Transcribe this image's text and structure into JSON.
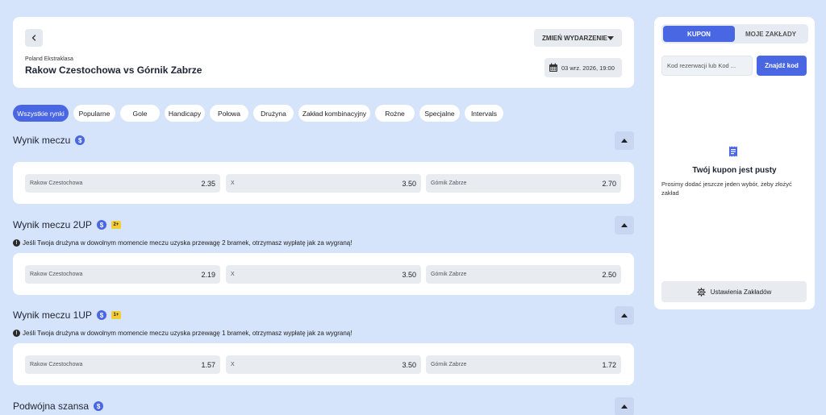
{
  "header": {
    "change_event_label": "ZMIEŃ WYDARZENIE",
    "league": "Poland Ekstraklasa",
    "match_title": "Rakow Czestochowa vs Górnik Zabrze",
    "datetime": "03 wrz. 2026, 19:00"
  },
  "tabs": [
    {
      "label": "Wszystkie rynki",
      "active": true
    },
    {
      "label": "Popularne"
    },
    {
      "label": "Gole"
    },
    {
      "label": "Handicapy"
    },
    {
      "label": "Połowa"
    },
    {
      "label": "Drużyna"
    },
    {
      "label": "Zakład kombinacyjny"
    },
    {
      "label": "Rożne"
    },
    {
      "label": "Specjalne"
    },
    {
      "label": "Intervals"
    }
  ],
  "markets": [
    {
      "title": "Wynik meczu",
      "odds": [
        {
          "label": "Rakow Czestochowa",
          "value": "2.35"
        },
        {
          "label": "X",
          "value": "3.50"
        },
        {
          "label": "Górnik Zabrze",
          "value": "2.70"
        }
      ]
    },
    {
      "title": "Wynik meczu 2UP",
      "badge": "2+",
      "info": "Jeśli Twoja drużyna w dowolnym momencie meczu uzyska przewagę 2 bramek, otrzymasz wypłatę jak za wygraną!",
      "odds": [
        {
          "label": "Rakow Czestochowa",
          "value": "2.19"
        },
        {
          "label": "X",
          "value": "3.50"
        },
        {
          "label": "Górnik Zabrze",
          "value": "2.50"
        }
      ]
    },
    {
      "title": "Wynik meczu 1UP",
      "badge": "1+",
      "info": "Jeśli Twoja drużyna w dowolnym momencie meczu uzyska przewagę 1 bramek, otrzymasz wypłatę jak za wygraną!",
      "odds": [
        {
          "label": "Rakow Czestochowa",
          "value": "1.57"
        },
        {
          "label": "X",
          "value": "3.50"
        },
        {
          "label": "Górnik Zabrze",
          "value": "1.72"
        }
      ]
    },
    {
      "title": "Podwójna szansa"
    }
  ],
  "coin_symbol": "$",
  "info_symbol": "!",
  "sidebar": {
    "tab_coupon": "KUPON",
    "tab_my_bets": "MOJE ZAKŁADY",
    "code_placeholder": "Kod rezerwacji lub Kod ...",
    "find_code_label": "Znajdź kod",
    "empty_title": "Twój kupon jest pusty",
    "empty_desc": "Prosimy dodać jeszcze jeden wybór, żeby złożyć zakład",
    "settings_label": "Ustawienia Zakładów"
  },
  "colors": {
    "accent": "#4a67e3",
    "background": "#d6e4fb",
    "badge": "#f4cd34"
  }
}
